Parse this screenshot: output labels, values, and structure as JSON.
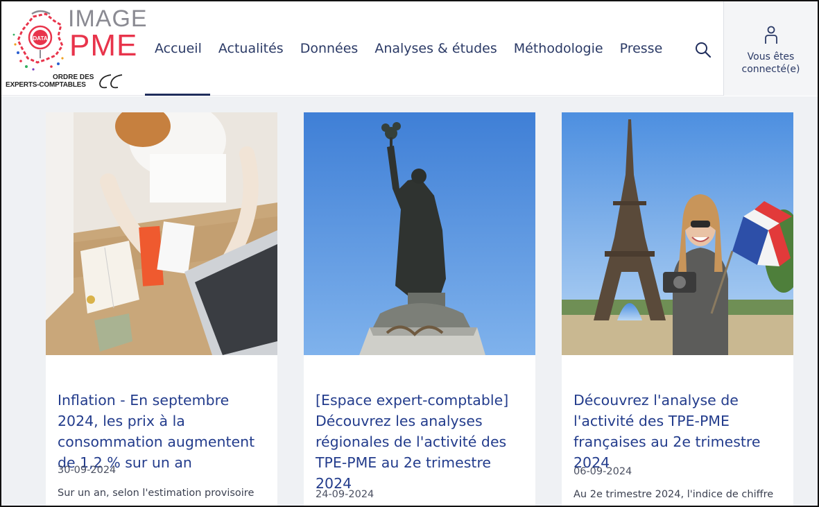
{
  "logo": {
    "top_text": "IMAGE",
    "bottom_text": "PME",
    "badge_text": "DATA",
    "org_line1": "ORDRE DES",
    "org_line2": "EXPERTS-COMPTABLES"
  },
  "nav": {
    "items": [
      {
        "label": "Accueil",
        "active": true
      },
      {
        "label": "Actualités",
        "active": false
      },
      {
        "label": "Données",
        "active": false
      },
      {
        "label": "Analyses & études",
        "active": false
      },
      {
        "label": "Méthodologie",
        "active": false
      },
      {
        "label": "Presse",
        "active": false
      }
    ],
    "search_icon": "search-icon"
  },
  "account": {
    "label": "Vous êtes connecté(e)",
    "icon": "user-icon"
  },
  "cards": [
    {
      "title": "Inflation - En septembre 2024, les prix à la consommation augmentent de 1,2 % sur un an",
      "date": "30-09-2024",
      "excerpt": "Sur un an, selon l'estimation provisoire"
    },
    {
      "title": "[Espace expert-comptable] Découvrez les analyses régionales de l'activité des TPE-PME au 2e trimestre 2024",
      "date": "24-09-2024",
      "excerpt": ""
    },
    {
      "title": "Découvrez l'analyse de l'activité des TPE-PME françaises au 2e trimestre 2024",
      "date": "06-09-2024",
      "excerpt": "Au 2e trimestre 2024, l'indice de chiffre"
    }
  ],
  "colors": {
    "brand_red": "#e8344b",
    "nav_text": "#2b3a66",
    "title_blue": "#233c8c",
    "page_bg": "#eff1f4"
  }
}
